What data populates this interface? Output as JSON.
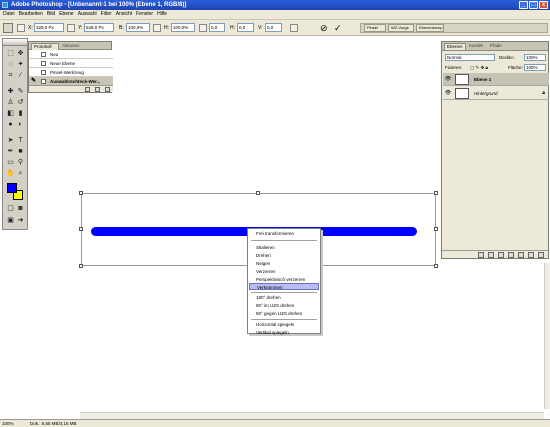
{
  "window": {
    "title": "Adobe Photoshop - [Unbenannt-1 bei 100% (Ebene 1, RGB/8)]",
    "buttons": [
      "_",
      "□",
      "x"
    ]
  },
  "menu": [
    "Datei",
    "Bearbeiten",
    "Bild",
    "Ebene",
    "Auswahl",
    "Filter",
    "Ansicht",
    "Fenster",
    "Hilfe"
  ],
  "options": {
    "x_label": "X:",
    "x_value": "329,0 Px",
    "y_label": "Y:",
    "y_value": "549,0 Px",
    "w_label": "B:",
    "w_value": "100,0%",
    "h_label": "H:",
    "h_value": "100,0%",
    "angle_value": "0,0",
    "hskew_label": "H:",
    "hskew_value": "0,0",
    "vskew_label": "V:",
    "vskew_value": "0,0",
    "cancel_symbol": "⊘",
    "commit_symbol": "✓",
    "well_tabs": [
      "Pinsel",
      "WZ-Vorgs",
      "Ebenenkomp."
    ]
  },
  "history": {
    "tabs": [
      "Protokoll",
      "Aktionen"
    ],
    "items": [
      {
        "label": "Neu",
        "selected": false
      },
      {
        "label": "Neue Ebene",
        "selected": false
      },
      {
        "label": "Pinsel-Werkzeug",
        "selected": false
      },
      {
        "label": "Auswahlrechteck-Wer...",
        "selected": true
      }
    ]
  },
  "context_menu": {
    "items": [
      {
        "label": "Frei transformieren",
        "highlighted": false
      },
      {
        "label": "Skalieren",
        "highlighted": false
      },
      {
        "label": "Drehen",
        "highlighted": false
      },
      {
        "label": "Neigen",
        "highlighted": false
      },
      {
        "label": "Verzerren",
        "highlighted": false
      },
      {
        "label": "Perspektivisch verzerren",
        "highlighted": false
      },
      {
        "label": "Verkrümmen",
        "highlighted": true
      },
      {
        "label": "180° drehen",
        "highlighted": false
      },
      {
        "label": "90° im UZS drehen",
        "highlighted": false
      },
      {
        "label": "90° gegen UZS drehen",
        "highlighted": false
      },
      {
        "label": "Horizontal spiegeln",
        "highlighted": false
      },
      {
        "label": "Vertikal spiegeln",
        "highlighted": false
      }
    ]
  },
  "layers": {
    "tabs": [
      "Ebenen",
      "Kanäle",
      "Pfade"
    ],
    "blend_mode": "Normal",
    "opacity_label": "Deckkr.:",
    "opacity_value": "100%",
    "fix_label": "Fixieren:",
    "fill_label": "Fläche:",
    "fill_value": "100%",
    "items": [
      {
        "name": "Ebene 1",
        "selected": true,
        "locked": false
      },
      {
        "name": "Hintergrund",
        "selected": false,
        "locked": true
      }
    ]
  },
  "status": {
    "zoom": "100%",
    "doc": "Dok.: 6,55 MB/3,16 MB"
  },
  "colors": {
    "foreground": "#0000ff",
    "background": "#ffff00",
    "bar": "#0000ff"
  }
}
